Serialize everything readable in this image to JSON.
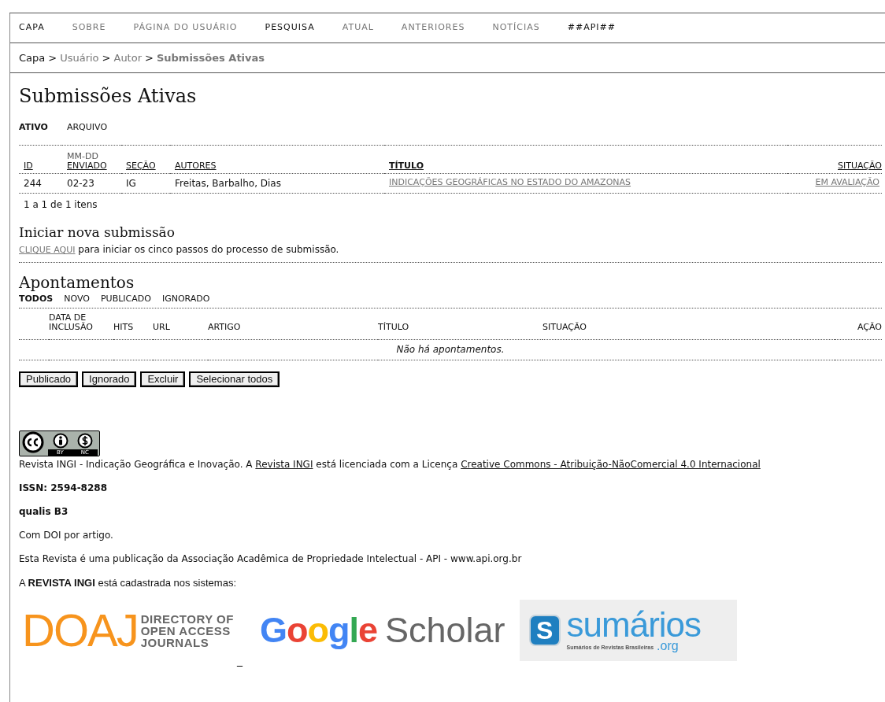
{
  "nav": [
    {
      "label": "CAPA",
      "dimmed": false
    },
    {
      "label": "SOBRE",
      "dimmed": true
    },
    {
      "label": "PÁGINA DO USUÁRIO",
      "dimmed": true
    },
    {
      "label": "PESQUISA",
      "dimmed": false
    },
    {
      "label": "ATUAL",
      "dimmed": true
    },
    {
      "label": "ANTERIORES",
      "dimmed": true
    },
    {
      "label": "NOTÍCIAS",
      "dimmed": true
    },
    {
      "label": "##API##",
      "dimmed": false
    }
  ],
  "breadcrumb": [
    {
      "label": "Capa",
      "kind": "home"
    },
    {
      "label": "Usuário",
      "kind": "link"
    },
    {
      "label": "Autor",
      "kind": "link"
    },
    {
      "label": "Submissões Ativas",
      "kind": "current"
    }
  ],
  "breadcrumb_separator": ">",
  "page_title": "Submissões Ativas",
  "tabs": [
    {
      "label": "ATIVO",
      "selected": true
    },
    {
      "label": "ARQUIVO",
      "selected": false
    }
  ],
  "submissions": {
    "columns": [
      {
        "label": "ID",
        "sorted": false
      },
      {
        "label": "ENVIADO",
        "note": "MM-DD",
        "sorted": false
      },
      {
        "label": "SEÇÃO",
        "sorted": false
      },
      {
        "label": "AUTORES",
        "sorted": false
      },
      {
        "label": "TÍTULO",
        "sorted": true
      },
      {
        "label": "SITUAÇÃO",
        "sorted": false
      }
    ],
    "rows": [
      {
        "id": "244",
        "submitted": "02-23",
        "section": "IG",
        "authors": "Freitas, Barbalho, Dias",
        "title": "INDICAÇÕES GEOGRÁFICAS NO ESTADO DO AMAZONAS",
        "status": "EM AVALIAÇÃO"
      }
    ],
    "count": "1 a 1 de 1 itens"
  },
  "new_submission": {
    "heading": "Iniciar nova submissão",
    "link": "CLIQUE AQUI",
    "text": "para iniciar os cinco passos do processo de submissão."
  },
  "notes": {
    "heading": "Apontamentos",
    "tabs": [
      {
        "label": "TODOS",
        "selected": true
      },
      {
        "label": "NOVO",
        "selected": false
      },
      {
        "label": "PUBLICADO",
        "selected": false
      },
      {
        "label": "IGNORADO",
        "selected": false
      }
    ],
    "columns": [
      "DATA DE INCLUSÃO",
      "HITS",
      "URL",
      "ARTIGO",
      "TÍTULO",
      "SITUAÇÃO",
      "AÇÃO"
    ],
    "empty": "Não há apontamentos.",
    "buttons": [
      "Publicado",
      "Ignorado",
      "Excluir",
      "Selecionar todos"
    ]
  },
  "footer": {
    "license": [
      {
        "kind": "text",
        "text": "Revista INGI - Indicação Geográfica e Inovação. A"
      },
      {
        "kind": "link",
        "text": "Revista INGI"
      },
      {
        "kind": "text",
        "text": "está licenciada com a Licença"
      },
      {
        "kind": "link",
        "text": "Creative Commons - Atribuição-NãoComercial 4.0 Internacional"
      }
    ],
    "cc_labels": [
      "BY",
      "NC"
    ],
    "issn": "ISSN: 2594-8288",
    "qualis": "qualis B3",
    "doi": "Com DOI por artigo.",
    "publisher": "Esta Revista é uma publicação da Associação Acadêmica de Propriedade Intelectual - API - www.api.org.br",
    "indexed": "A **REVISTA INGI** está cadastrada nos sistemas:",
    "doaj": {
      "mark": "DOAJ",
      "lines": [
        "DIRECTORY OF",
        "OPEN ACCESS",
        "JOURNALS"
      ]
    },
    "stray": "_",
    "google": {
      "word": "Google",
      "rest": "Scholar"
    },
    "sumarios": {
      "letter": "S",
      "word": "sumários",
      "tagline": "Sumários de Revistas Brasileiras",
      "suffix": ".org"
    }
  }
}
